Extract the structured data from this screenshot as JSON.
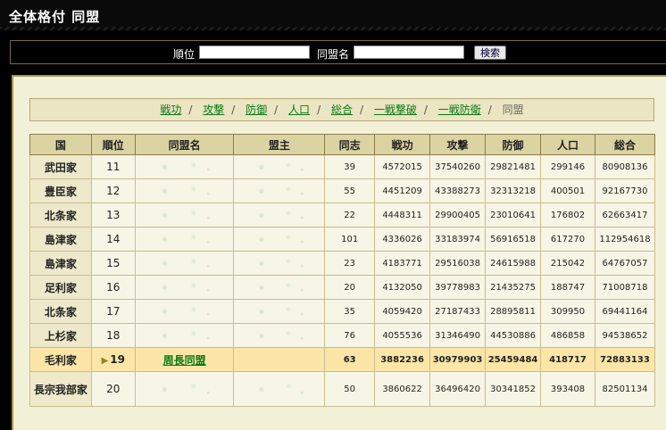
{
  "header": {
    "title": "全体格付 同盟"
  },
  "search": {
    "rank_label": "順位",
    "rank_value": "",
    "alliance_label": "同盟名",
    "alliance_value": "",
    "button_label": "検索"
  },
  "nav": {
    "links": [
      "戦功",
      "攻撃",
      "防御",
      "人口",
      "総合",
      "一戦撃破",
      "一戦防衛"
    ],
    "current": "同盟",
    "separator": "/"
  },
  "table": {
    "headers": [
      "国",
      "順位",
      "同盟名",
      "盟主",
      "同志",
      "戦功",
      "攻撃",
      "防御",
      "人口",
      "総合"
    ],
    "rows": [
      {
        "country": "武田家",
        "rank": "11",
        "alliance": "",
        "leader": "",
        "members": "39",
        "merit": "4572015",
        "attack": "37540260",
        "defense": "29821481",
        "population": "299146",
        "total": "80908136"
      },
      {
        "country": "豊臣家",
        "rank": "12",
        "alliance": "",
        "leader": "",
        "members": "55",
        "merit": "4451209",
        "attack": "43388273",
        "defense": "32313218",
        "population": "400501",
        "total": "92167730"
      },
      {
        "country": "北条家",
        "rank": "13",
        "alliance": "",
        "leader": "",
        "members": "22",
        "merit": "4448311",
        "attack": "29900405",
        "defense": "23010641",
        "population": "176802",
        "total": "62663417"
      },
      {
        "country": "島津家",
        "rank": "14",
        "alliance": "",
        "leader": "",
        "members": "101",
        "merit": "4336026",
        "attack": "33183974",
        "defense": "56916518",
        "population": "617270",
        "total": "112954618"
      },
      {
        "country": "島津家",
        "rank": "15",
        "alliance": "",
        "leader": "",
        "members": "23",
        "merit": "4183771",
        "attack": "29516038",
        "defense": "24615988",
        "population": "215042",
        "total": "64767057"
      },
      {
        "country": "足利家",
        "rank": "16",
        "alliance": "",
        "leader": "",
        "members": "20",
        "merit": "4132050",
        "attack": "39778983",
        "defense": "21435275",
        "population": "188747",
        "total": "71008718"
      },
      {
        "country": "北条家",
        "rank": "17",
        "alliance": "",
        "leader": "",
        "members": "35",
        "merit": "4059420",
        "attack": "27187433",
        "defense": "28895811",
        "population": "309950",
        "total": "69441164"
      },
      {
        "country": "上杉家",
        "rank": "18",
        "alliance": "",
        "leader": "",
        "members": "76",
        "merit": "4055536",
        "attack": "31346490",
        "defense": "44530886",
        "population": "486858",
        "total": "94538652"
      },
      {
        "country": "毛利家",
        "rank": "19",
        "alliance": "周長同盟",
        "leader": "",
        "members": "63",
        "merit": "3882236",
        "attack": "30979903",
        "defense": "25459484",
        "population": "418717",
        "total": "72883133"
      },
      {
        "country": "長宗我部家",
        "rank": "20",
        "alliance": "",
        "leader": "",
        "members": "50",
        "merit": "3860622",
        "attack": "36496420",
        "defense": "30341852",
        "population": "393408",
        "total": "82501134"
      }
    ]
  }
}
